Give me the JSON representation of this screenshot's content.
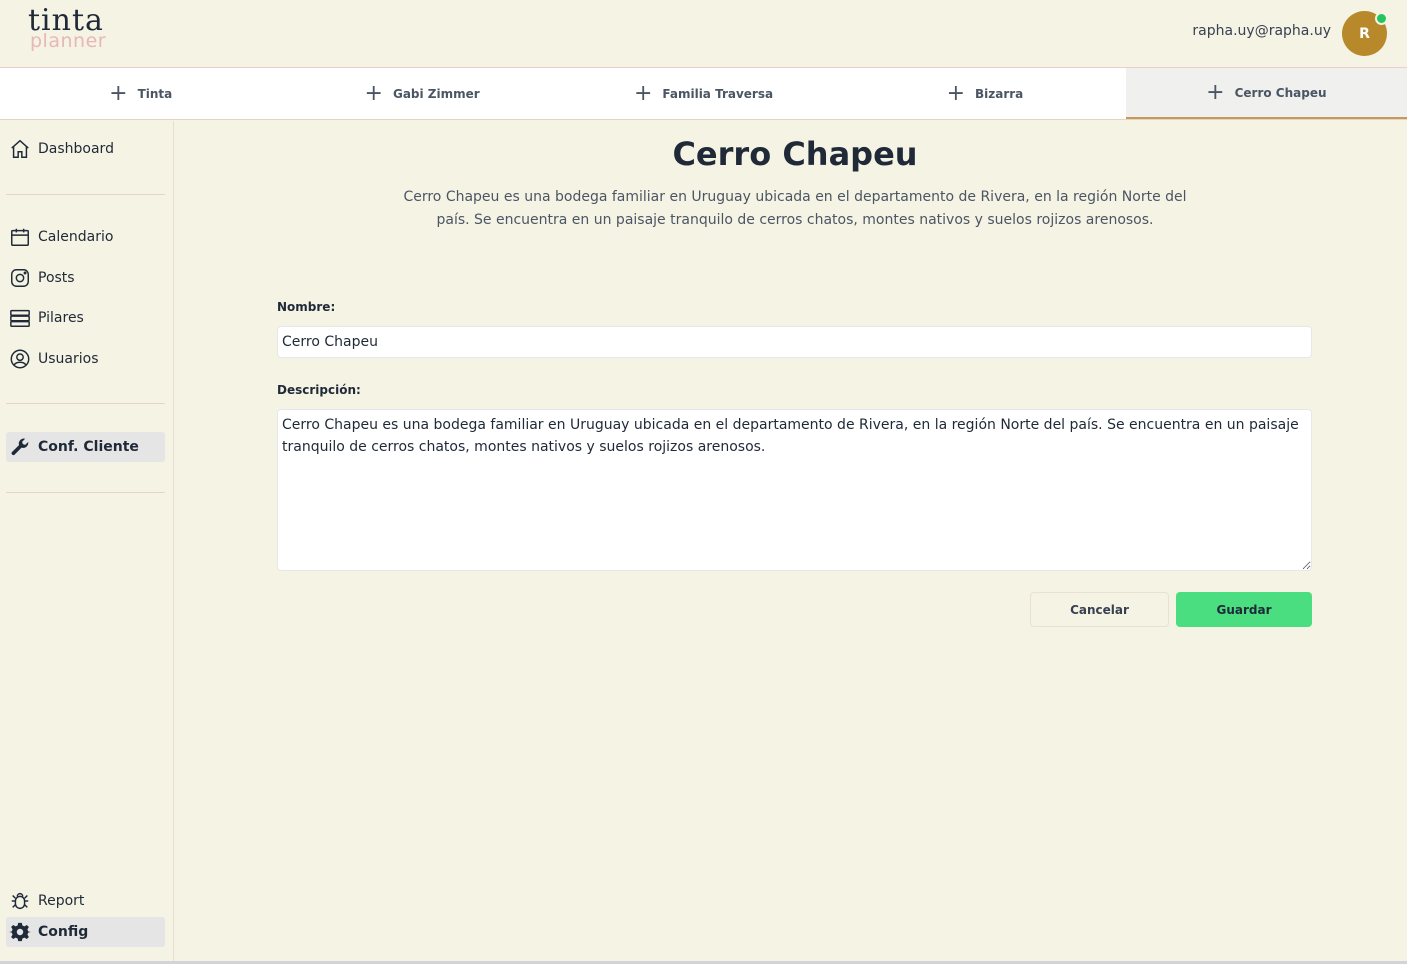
{
  "header": {
    "logo_main": "tinta",
    "logo_sub": "planner",
    "user_email": "rapha.uy@rapha.uy",
    "avatar_initial": "R"
  },
  "tabs": [
    {
      "label": "Tinta",
      "active": false
    },
    {
      "label": "Gabi Zimmer",
      "active": false
    },
    {
      "label": "Familia Traversa",
      "active": false
    },
    {
      "label": "Bizarra",
      "active": false
    },
    {
      "label": "Cerro Chapeu",
      "active": true
    }
  ],
  "sidebar": {
    "dashboard": "Dashboard",
    "calendario": "Calendario",
    "posts": "Posts",
    "pilares": "Pilares",
    "usuarios": "Usuarios",
    "conf_cliente": "Conf. Cliente",
    "report": "Report",
    "config": "Config"
  },
  "main": {
    "title": "Cerro Chapeu",
    "description": "Cerro Chapeu es una bodega familiar en Uruguay ubicada en el departamento de Rivera, en la región Norte del país. Se encuentra en un paisaje tranquilo de cerros chatos, montes nativos y suelos rojizos arenosos.",
    "nombre_label": "Nombre:",
    "nombre_value": "Cerro Chapeu",
    "descripcion_label": "Descripción:",
    "descripcion_value": "Cerro Chapeu es una bodega familiar en Uruguay ubicada en el departamento de Rivera, en la región Norte del país. Se encuentra en un paisaje tranquilo de cerros chatos, montes nativos y suelos rojizos arenosos.",
    "cancel_label": "Cancelar",
    "save_label": "Guardar"
  },
  "colors": {
    "background": "#f5f3e4",
    "accent_save": "#4ade80",
    "avatar": "#b8892a",
    "online": "#22c55e"
  }
}
